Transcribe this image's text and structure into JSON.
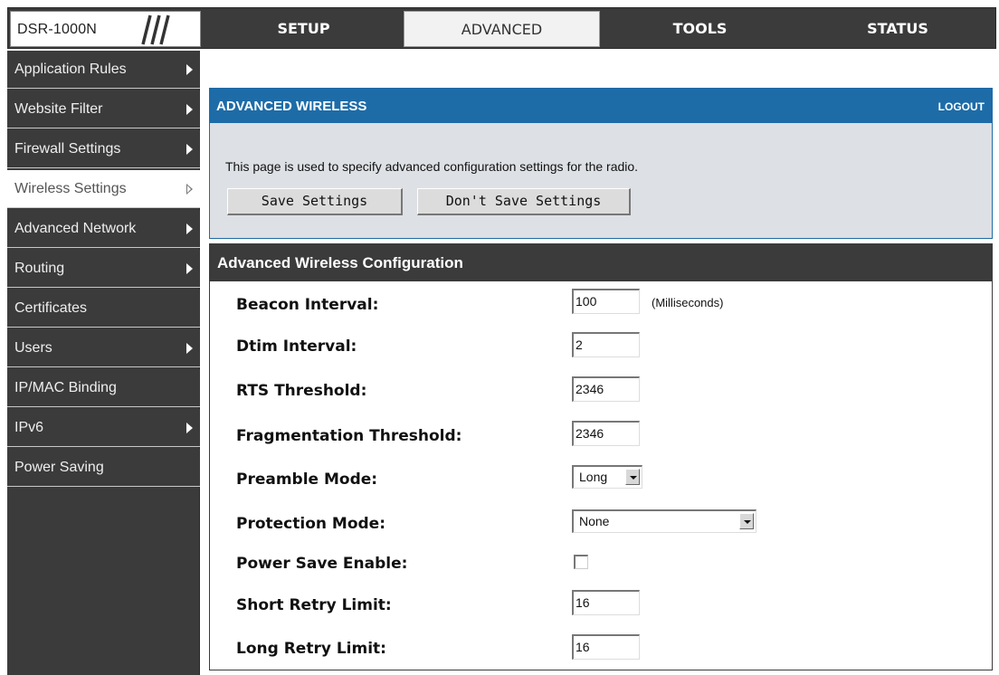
{
  "logo": {
    "text": "DSR-1000N"
  },
  "top_tabs": [
    {
      "label": "SETUP",
      "active": false
    },
    {
      "label": "ADVANCED",
      "active": true
    },
    {
      "label": "TOOLS",
      "active": false
    },
    {
      "label": "STATUS",
      "active": false
    }
  ],
  "sidebar": {
    "items": [
      {
        "label": "Application Rules",
        "has_arrow": true,
        "active": false
      },
      {
        "label": "Website Filter",
        "has_arrow": true,
        "active": false
      },
      {
        "label": "Firewall Settings",
        "has_arrow": true,
        "active": false
      },
      {
        "label": "Wireless Settings",
        "has_arrow": true,
        "active": true
      },
      {
        "label": "Advanced Network",
        "has_arrow": true,
        "active": false
      },
      {
        "label": "Routing",
        "has_arrow": true,
        "active": false
      },
      {
        "label": "Certificates",
        "has_arrow": false,
        "active": false
      },
      {
        "label": "Users",
        "has_arrow": true,
        "active": false
      },
      {
        "label": "IP/MAC Binding",
        "has_arrow": false,
        "active": false
      },
      {
        "label": "IPv6",
        "has_arrow": true,
        "active": false
      },
      {
        "label": "Power Saving",
        "has_arrow": false,
        "active": false
      }
    ]
  },
  "advanced_panel": {
    "title": "ADVANCED WIRELESS",
    "logout": "LOGOUT",
    "description": "This page is used to specify advanced configuration settings for the radio.",
    "save_button": "Save Settings",
    "dont_save_button": "Don't Save Settings"
  },
  "config": {
    "title": "Advanced Wireless Configuration",
    "beacon_interval": {
      "label": "Beacon Interval:",
      "value": "100",
      "unit": "(Milliseconds)"
    },
    "dtim_interval": {
      "label": "Dtim Interval:",
      "value": "2"
    },
    "rts_threshold": {
      "label": "RTS Threshold:",
      "value": "2346"
    },
    "fragmentation_threshold": {
      "label": "Fragmentation Threshold:",
      "value": "2346"
    },
    "preamble_mode": {
      "label": "Preamble Mode:",
      "value": "Long"
    },
    "protection_mode": {
      "label": "Protection Mode:",
      "value": "None"
    },
    "power_save_enable": {
      "label": "Power Save Enable:",
      "checked": false
    },
    "short_retry_limit": {
      "label": "Short Retry Limit:",
      "value": "16"
    },
    "long_retry_limit": {
      "label": "Long Retry Limit:",
      "value": "16"
    }
  },
  "colors": {
    "header_blue": "#1d6ca8",
    "dark_gray": "#3b3b3b",
    "panel_bg": "#dde0e4"
  }
}
